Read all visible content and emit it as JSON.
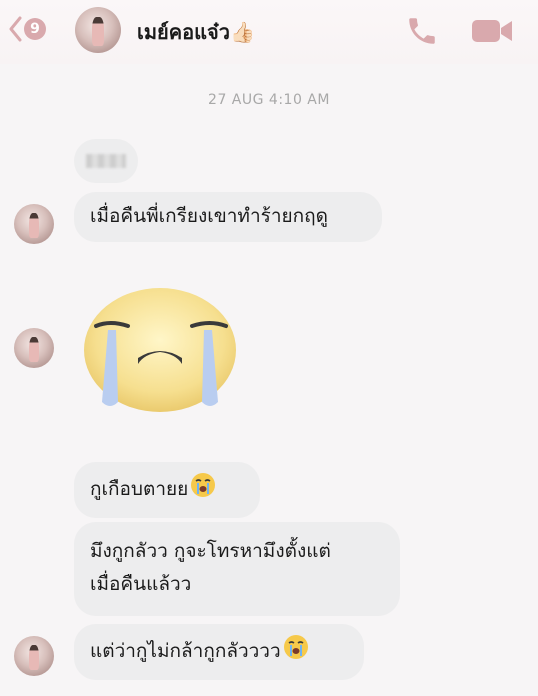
{
  "header": {
    "back_badge": "9",
    "contact_name": "เมย์คอแจ๋ว👍🏻",
    "icons": [
      "back-chevron-icon",
      "phone-icon",
      "video-camera-icon"
    ]
  },
  "timestamp": "27 AUG 4:10 AM",
  "messages": [
    {
      "text": "เมื่อคืนพี่เกรียงเขาทำร้ายกฤดู"
    },
    {
      "sticker": "crying-face-sticker"
    },
    {
      "text": "กูเกือบตายย"
    },
    {
      "line1": "มึงกูกลัวว กูจะโทรหามึงตั้งแต่",
      "line2": "เมื่อคืนแล้วว"
    },
    {
      "text": "แต่ว่ากูไม่กล้ากูกลัวววว"
    }
  ],
  "colors": {
    "accent": "#d9a9ad",
    "bubble": "#ededee",
    "background": "#f7f5f6",
    "timestamp": "#a8a8a8"
  }
}
